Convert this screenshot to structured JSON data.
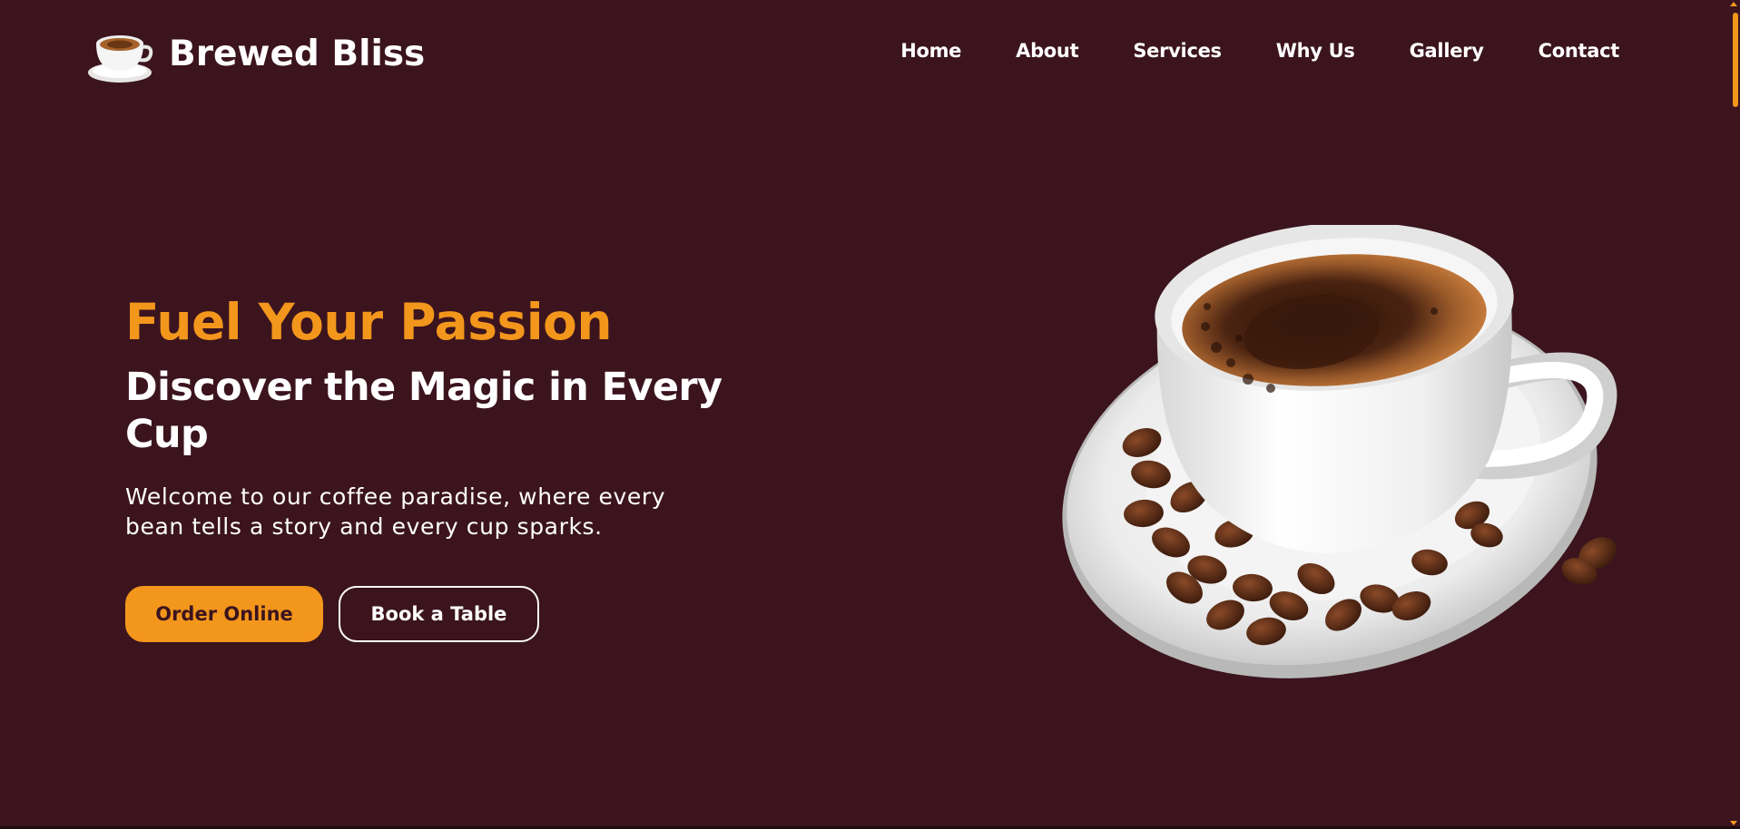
{
  "brand": {
    "name": "Brewed Bliss",
    "logo_icon": "coffee-cup-icon"
  },
  "nav": {
    "items": [
      {
        "label": "Home"
      },
      {
        "label": "About"
      },
      {
        "label": "Services"
      },
      {
        "label": "Why Us"
      },
      {
        "label": "Gallery"
      },
      {
        "label": "Contact"
      }
    ]
  },
  "hero": {
    "subtitle": "Fuel Your Passion",
    "title": "Discover the Magic in Every Cup",
    "description": "Welcome to our coffee paradise, where every bean tells a story and every cup sparks.",
    "order_button": "Order Online",
    "book_button": "Book a Table",
    "image_icon": "coffee-cup-with-beans-icon"
  },
  "colors": {
    "background": "#3b141e",
    "accent": "#f3961c",
    "text": "#ffffff"
  }
}
